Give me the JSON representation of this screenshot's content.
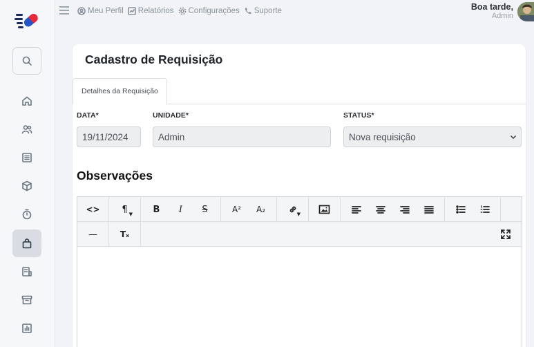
{
  "topnav": {
    "items": [
      {
        "label": "Meu Perfil",
        "icon": "user-circle-icon"
      },
      {
        "label": "Relatórios",
        "icon": "chart-icon"
      },
      {
        "label": "Configurações",
        "icon": "gear-icon"
      },
      {
        "label": "Suporte",
        "icon": "phone-icon"
      }
    ]
  },
  "user": {
    "greeting": "Boa tarde,",
    "name": "Admin"
  },
  "page": {
    "title": "Cadastro de Requisição",
    "tab": "Detalhes da Requisição"
  },
  "form": {
    "data_label": "DATA*",
    "data_value": "19/11/2024",
    "unidade_label": "UNIDADE*",
    "unidade_value": "Admin",
    "status_label": "STATUS*",
    "status_value": "Nova requisição"
  },
  "observacoes": {
    "title": "Observações"
  },
  "editor": {
    "toolbar": {
      "code": "<>",
      "paragraph": "¶",
      "bold": "B",
      "italic": "I",
      "strike": "S",
      "superscript": "A²",
      "subscript": "A₂",
      "hr": "—",
      "clear_format": "Tₓ"
    }
  },
  "colors": {
    "accent": "#1f6fd1",
    "sidebar_active": "#d9dde3",
    "background": "#f1f3f6"
  }
}
